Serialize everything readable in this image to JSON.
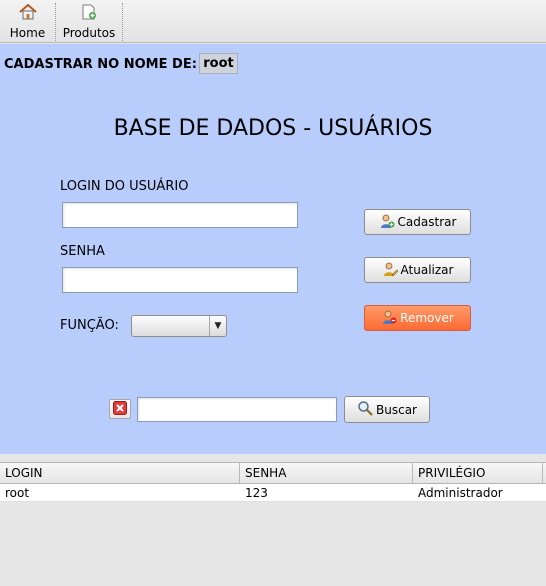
{
  "toolbar": {
    "home_label": "Home",
    "products_label": "Produtos"
  },
  "owner": {
    "label": "CADASTRAR NO NOME DE:",
    "value": "root"
  },
  "page_title": "BASE DE DADOS - USUÁRIOS",
  "form": {
    "login_label": "LOGIN DO USUÁRIO",
    "login_value": "",
    "password_label": "SENHA",
    "password_value": "",
    "role_label": "FUNÇÃO:",
    "role_value": ""
  },
  "actions": {
    "register_label": "Cadastrar",
    "update_label": "Atualizar",
    "remove_label": "Remover"
  },
  "search": {
    "value": "",
    "button_label": "Buscar"
  },
  "table": {
    "columns": [
      "LOGIN",
      "SENHA",
      "PRIVILÉGIO"
    ],
    "rows": [
      [
        "root",
        "123",
        "Administrador"
      ]
    ]
  },
  "colors": {
    "panel_background": "#b9cdfd",
    "remove_button": "#ff7a43"
  },
  "icons": {
    "home": "house-icon",
    "products": "add-document-icon",
    "register": "add-user-icon",
    "update": "edit-user-icon",
    "remove": "remove-user-icon",
    "clear": "red-x-icon",
    "search": "magnifier-icon"
  }
}
